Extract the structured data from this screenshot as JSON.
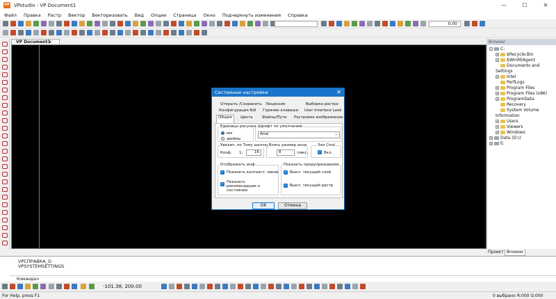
{
  "window": {
    "title": "VPstudio - VP Document1",
    "logo_text": "VP"
  },
  "window_controls": {
    "minimize": "—",
    "maximize": "☐",
    "close": "✕"
  },
  "menu": [
    "Файл",
    "Правка",
    "Растр",
    "Вектор",
    "Векторизовать",
    "Вид",
    "Опции",
    "Страница",
    "Окно",
    "Подчеркнуть изменения",
    "Справка"
  ],
  "toolbar": {
    "zoom_value": "0.00"
  },
  "document_tab": {
    "label": "VP Document1",
    "close": "×"
  },
  "browser": {
    "title": "Browser",
    "tree": [
      {
        "label": "C:",
        "kind": "drive",
        "expander": "−",
        "level": 0
      },
      {
        "label": "$Recycle.Bin",
        "kind": "folder",
        "expander": "+",
        "level": 1
      },
      {
        "label": "$WinREAgent",
        "kind": "folder",
        "expander": "+",
        "level": 1
      },
      {
        "label": "Documents and Settings",
        "kind": "folder",
        "expander": "",
        "level": 1
      },
      {
        "label": "Intel",
        "kind": "folder",
        "expander": "+",
        "level": 1
      },
      {
        "label": "PerfLogs",
        "kind": "folder",
        "expander": "",
        "level": 1
      },
      {
        "label": "Program Files",
        "kind": "folder",
        "expander": "+",
        "level": 1
      },
      {
        "label": "Program Files (x86)",
        "kind": "folder",
        "expander": "+",
        "level": 1
      },
      {
        "label": "ProgramData",
        "kind": "folder",
        "expander": "+",
        "level": 1
      },
      {
        "label": "Recovery",
        "kind": "folder",
        "expander": "",
        "level": 1
      },
      {
        "label": "System Volume Information",
        "kind": "folder",
        "expander": "",
        "level": 1
      },
      {
        "label": "Users",
        "kind": "folder",
        "expander": "+",
        "level": 1
      },
      {
        "label": "Viewers",
        "kind": "folder",
        "expander": "+",
        "level": 1
      },
      {
        "label": "Windows",
        "kind": "folder",
        "expander": "+",
        "level": 1
      },
      {
        "label": "Data (D:\\)",
        "kind": "drive",
        "expander": "+",
        "level": 0
      },
      {
        "label": "E:",
        "kind": "drive",
        "expander": "+",
        "level": 0
      }
    ],
    "tabs": [
      "Проект",
      "Browser"
    ]
  },
  "command": {
    "history": [
      "VPСПРАВКА_O",
      "VPSYSTEMSETTINGS"
    ],
    "prompt": "Команда>"
  },
  "bottom_toolbar": {
    "coords": "-101.38,  200.00"
  },
  "status": {
    "help": "For Help, press F1",
    "selected": "0 выбрано",
    "color": "R:000 G:000 B:000"
  },
  "dialog": {
    "title": "Системные настройки",
    "close": "✕",
    "tabs_row1": [
      "Открыть /Сохранить",
      "Лицензия",
      "Выборка растра"
    ],
    "tabs_row2": [
      "Конфигурация Rdl",
      "Горячие клавиши",
      "User Interface Look"
    ],
    "tabs_row3": [
      "Общие",
      "Цвета",
      "Файлы/Пути",
      "Растровое изображение"
    ],
    "units_group": "Единицы рисунка",
    "unit_mm": "мм",
    "unit_inch": "дюймы",
    "font_group": "Шрифт по умолчанию",
    "font_value": "Arial",
    "wheel_zoom_group": "Увелич. по Тому шелчку",
    "coef_label": "Коэф.",
    "coef_a": "1:",
    "coef_b": "16",
    "snap_group": "Взять размер окна",
    "snap_value": "8",
    "snap_unit": "пикс.",
    "echo_group": "Эхо Cmd",
    "echo_label": "Вкл.",
    "display_group": "Отображать инф.",
    "show_context_menu": "Показать контекст. меню",
    "show_recommendations": "Показать рекомендации о состоянии",
    "warn_group": "Показать предупреждения",
    "warn_layer": "Выкл. текущий слой",
    "warn_raster": "Выкл. текущий растр",
    "ok": "OK",
    "cancel": "Отмена"
  },
  "colors": {
    "accent": "#1a74c9",
    "canvas": "#000000",
    "guide": "#3aa14a"
  }
}
